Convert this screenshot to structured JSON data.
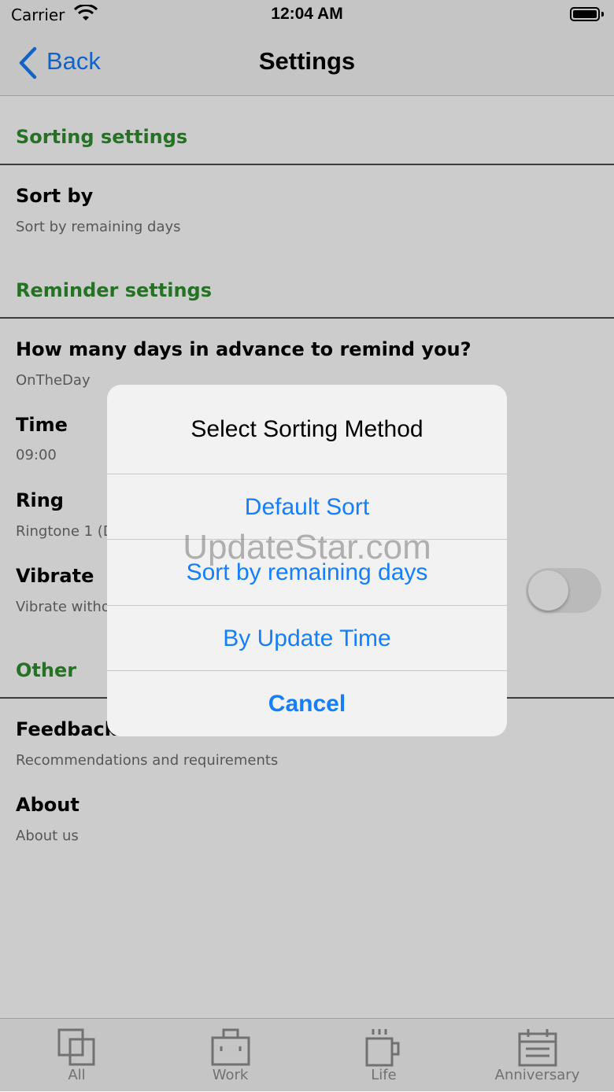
{
  "status_bar": {
    "carrier": "Carrier",
    "time": "12:04 AM"
  },
  "nav": {
    "back_label": "Back",
    "title": "Settings"
  },
  "sections": {
    "sorting": "Sorting settings",
    "reminder": "Reminder settings",
    "other": "Other"
  },
  "items": {
    "sort_by": {
      "title": "Sort by",
      "value": "Sort by remaining days"
    },
    "advance": {
      "title": "How many days in advance to remind you?",
      "value": "OnTheDay"
    },
    "time": {
      "title": "Time",
      "value": "09:00"
    },
    "ring": {
      "title": "Ring",
      "value": "Ringtone 1 (D"
    },
    "vibrate": {
      "title": "Vibrate",
      "value": "Vibrate witho",
      "enabled": false
    },
    "feedback": {
      "title": "Feedback",
      "value": "Recommendations and requirements"
    },
    "about": {
      "title": "About",
      "value": "About us"
    }
  },
  "alert": {
    "title": "Select Sorting Method",
    "options": [
      "Default Sort",
      "Sort by remaining days",
      "By Update Time"
    ],
    "cancel": "Cancel"
  },
  "tabs": [
    {
      "label": "All",
      "icon": "all-icon"
    },
    {
      "label": "Work",
      "icon": "briefcase-icon"
    },
    {
      "label": "Life",
      "icon": "cup-icon"
    },
    {
      "label": "Anniversary",
      "icon": "calendar-icon"
    }
  ],
  "watermark": "UpdateStar.com",
  "colors": {
    "accent": "#147efb",
    "section": "#2f8f2f"
  }
}
